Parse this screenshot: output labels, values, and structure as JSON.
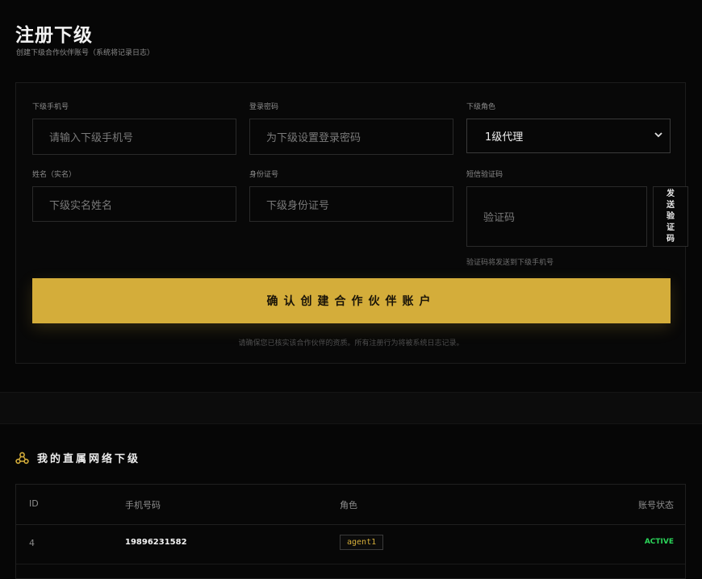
{
  "header": {
    "title": "注册下级",
    "subtitle": "创建下级合作伙伴账号（系统将记录日志）"
  },
  "form": {
    "phone": {
      "label": "下级手机号",
      "placeholder": "请输入下级手机号"
    },
    "password": {
      "label": "登录密码",
      "placeholder": "为下级设置登录密码"
    },
    "role": {
      "label": "下级角色",
      "selected": "1级代理"
    },
    "name": {
      "label": "姓名（实名）",
      "placeholder": "下级实名姓名"
    },
    "id_number": {
      "label": "身份证号",
      "placeholder": "下级身份证号"
    },
    "sms_code": {
      "label": "短信验证码",
      "placeholder": "验证码",
      "send_label": [
        "发",
        "送",
        "验",
        "证",
        "码"
      ],
      "hint": "验证码将发送到下级手机号"
    },
    "submit_label": "确认创建合作伙伴账户",
    "footnote": "请确保您已核实该合作伙伴的资质。所有注册行为将被系统日志记录。"
  },
  "network": {
    "title": "我的直属网络下级",
    "columns": {
      "id": "ID",
      "phone": "手机号码",
      "role": "角色",
      "status": "账号状态"
    },
    "rows": [
      {
        "id": "4",
        "phone": "19896231582",
        "role": "agent1",
        "status": "ACTIVE"
      }
    ]
  },
  "colors": {
    "accent": "#d4ad3a",
    "active": "#2bd65a",
    "background": "#060606"
  }
}
